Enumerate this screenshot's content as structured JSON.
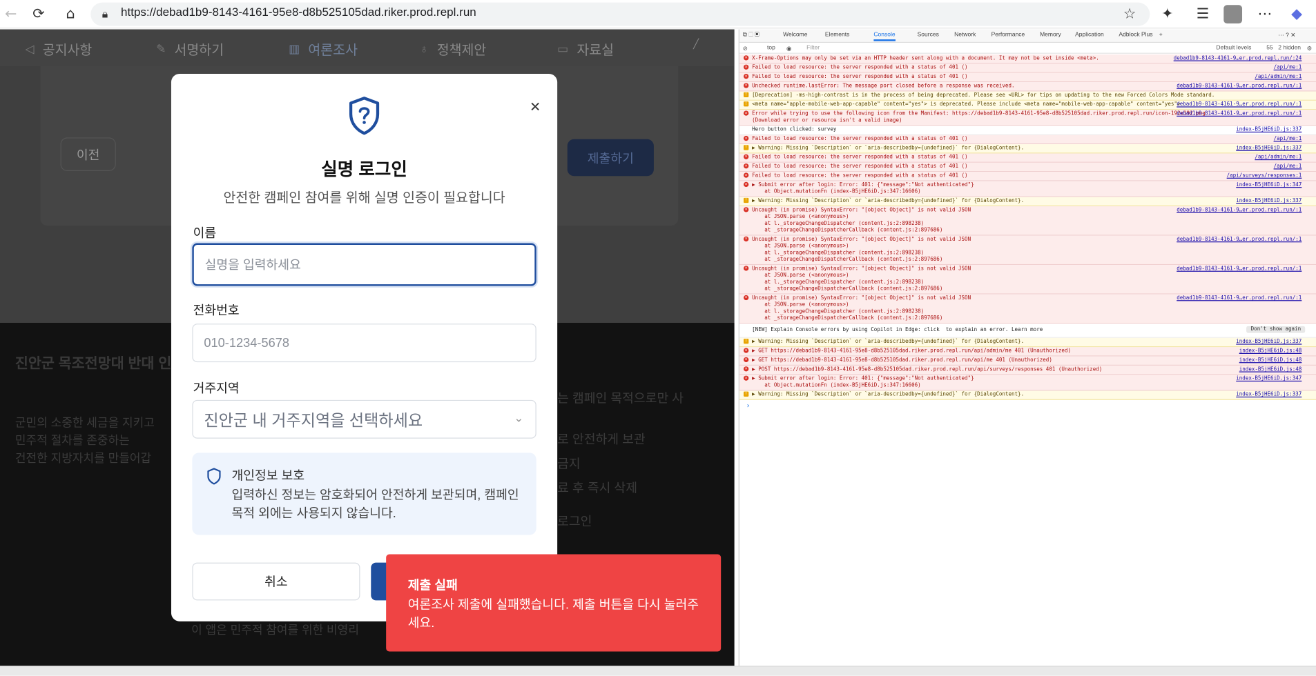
{
  "browser": {
    "url": "https://debad1b9-8143-4161-95e8-d8b525105dad.riker.prod.repl.run"
  },
  "nav": {
    "items": [
      "공지사항",
      "서명하기",
      "여론조사",
      "정책제안",
      "자료실"
    ]
  },
  "form": {
    "prev_label": "이전",
    "submit_label": "제출하기"
  },
  "footer": {
    "heading": "진안군 목조전망대 반대 인",
    "lines": [
      "군민의 소중한 세금을 지키고",
      "민주적 절차를 존중하는",
      "건전한 지방자치를 만들어갑"
    ],
    "right_lines": [
      "는 캠페인 목적으로만 사",
      "로 안전하게 보관",
      "금지",
      "료 후 즉시 삭제",
      "로그인"
    ],
    "note": "이 앱은 민주적 참여를 위한 비영리"
  },
  "modal": {
    "title": "실명 로그인",
    "subtitle": "안전한 캠페인 참여를 위해 실명 인증이 필요합니다",
    "name_label": "이름",
    "name_placeholder": "실명을 입력하세요",
    "phone_label": "전화번호",
    "phone_placeholder": "010-1234-5678",
    "region_label": "거주지역",
    "region_placeholder": "진안군 내 거주지역을 선택하세요",
    "privacy_title": "개인정보 보호",
    "privacy_body": "입력하신 정보는 암호화되어 안전하게 보관되며, 캠페인 목적 외에는 사용되지 않습니다.",
    "cancel_label": "취소"
  },
  "toast": {
    "title": "제출 실패",
    "message": "여론조사 제출에 실패했습니다. 제출 버튼을 다시 눌러주세요."
  },
  "devtools": {
    "tabs": [
      "Welcome",
      "Elements",
      "Console",
      "Sources",
      "Network",
      "Performance",
      "Memory",
      "Application",
      "Adblock Plus"
    ],
    "context": "top",
    "filter_placeholder": "Filter",
    "levels": "Default levels",
    "issues": "55",
    "hidden": "2 hidden",
    "rows": [
      {
        "t": "err",
        "msg": "X-Frame-Options may only be set via an HTTP header sent along with a document. It may not be set inside <meta>.",
        "src": "debad1b9-8143-4161-9…er.prod.repl.run/:24"
      },
      {
        "t": "err",
        "msg": "Failed to load resource: the server responded with a status of 401 ()",
        "src": "/api/me:1"
      },
      {
        "t": "err",
        "msg": "Failed to load resource: the server responded with a status of 401 ()",
        "src": "/api/admin/me:1"
      },
      {
        "t": "err",
        "msg": "Unchecked runtime.lastError: The message port closed before a response was received.",
        "src": "debad1b9-8143-4161-9…er.prod.repl.run/:1"
      },
      {
        "t": "warn",
        "msg": "[Deprecation] -ms-high-contrast is in the process of being deprecated. Please see <URL> for tips on updating to the new Forced Colors Mode standard.",
        "src": ""
      },
      {
        "t": "warn",
        "msg": "<meta name=\"apple-mobile-web-app-capable\" content=\"yes\"> is deprecated. Please include <meta name=\"mobile-web-app-capable\" content=\"yes\">",
        "src": "debad1b9-8143-4161-9…er.prod.repl.run/:1"
      },
      {
        "t": "err",
        "msg": "Error while trying to use the following icon from the Manifest: https://debad1b9-8143-4161-95e8-d8b525105dad.riker.prod.repl.run/icon-192x192.png\n(Download error or resource isn't a valid image)",
        "src": "debad1b9-8143-4161-9…er.prod.repl.run/:1"
      },
      {
        "t": "info",
        "msg": "Hero button clicked: survey",
        "src": "index-B5jHE6iD.js:337"
      },
      {
        "t": "err",
        "msg": "Failed to load resource: the server responded with a status of 401 ()",
        "src": "/api/me:1"
      },
      {
        "t": "warn",
        "msg": "▶ Warning: Missing `Description` or `aria-describedby={undefined}` for {DialogContent}.",
        "src": "index-B5jHE6iD.js:337"
      },
      {
        "t": "err",
        "msg": "Failed to load resource: the server responded with a status of 401 ()",
        "src": "/api/admin/me:1"
      },
      {
        "t": "err",
        "msg": "Failed to load resource: the server responded with a status of 401 ()",
        "src": "/api/me:1"
      },
      {
        "t": "err",
        "msg": "Failed to load resource: the server responded with a status of 401 ()",
        "src": "/api/surveys/responses:1"
      },
      {
        "t": "err",
        "msg": "▶ Submit error after login: Error: 401: {\"message\":\"Not authenticated\"}\n    at Object.mutationFn (index-B5jHE6iD.js:347:16606)",
        "src": "index-B5jHE6iD.js:347"
      },
      {
        "t": "warn",
        "msg": "▶ Warning: Missing `Description` or `aria-describedby={undefined}` for {DialogContent}.",
        "src": "index-B5jHE6iD.js:337"
      },
      {
        "t": "err",
        "msg": "Uncaught (in promise) SyntaxError: \"[object Object]\" is not valid JSON\n    at JSON.parse (<anonymous>)\n    at l._storageChangeDispatcher (content.js:2:898238)\n    at _storageChangeDispatcherCallback (content.js:2:897686)",
        "src": "debad1b9-8143-4161-9…er.prod.repl.run/:1"
      },
      {
        "t": "err",
        "msg": "Uncaught (in promise) SyntaxError: \"[object Object]\" is not valid JSON\n    at JSON.parse (<anonymous>)\n    at l._storageChangeDispatcher (content.js:2:898238)\n    at _storageChangeDispatcherCallback (content.js:2:897686)",
        "src": "debad1b9-8143-4161-9…er.prod.repl.run/:1"
      },
      {
        "t": "err",
        "msg": "Uncaught (in promise) SyntaxError: \"[object Object]\" is not valid JSON\n    at JSON.parse (<anonymous>)\n    at l._storageChangeDispatcher (content.js:2:898238)\n    at _storageChangeDispatcherCallback (content.js:2:897686)",
        "src": "debad1b9-8143-4161-9…er.prod.repl.run/:1"
      },
      {
        "t": "err",
        "msg": "Uncaught (in promise) SyntaxError: \"[object Object]\" is not valid JSON\n    at JSON.parse (<anonymous>)\n    at l._storageChangeDispatcher (content.js:2:898238)\n    at _storageChangeDispatcherCallback (content.js:2:897686)",
        "src": "debad1b9-8143-4161-9…er.prod.repl.run/:1"
      },
      {
        "t": "copilot",
        "msg": "[NEW] Explain Console errors by using Copilot in Edge: click  to explain an error. Learn more",
        "src": "Don't show again"
      },
      {
        "t": "warn",
        "msg": "▶ Warning: Missing `Description` or `aria-describedby={undefined}` for {DialogContent}.",
        "src": "index-B5jHE6iD.js:337"
      },
      {
        "t": "err",
        "msg": "▶ GET https://debad1b9-8143-4161-95e8-d8b525105dad.riker.prod.repl.run/api/admin/me 401 (Unauthorized)",
        "src": "index-B5jHE6iD.js:48"
      },
      {
        "t": "err",
        "msg": "▶ GET https://debad1b9-8143-4161-95e8-d8b525105dad.riker.prod.repl.run/api/me 401 (Unauthorized)",
        "src": "index-B5jHE6iD.js:48"
      },
      {
        "t": "err",
        "msg": "▶ POST https://debad1b9-8143-4161-95e8-d8b525105dad.riker.prod.repl.run/api/surveys/responses 401 (Unauthorized)",
        "src": "index-B5jHE6iD.js:48"
      },
      {
        "t": "err",
        "msg": "▶ Submit error after login: Error: 401: {\"message\":\"Not authenticated\"}\n    at Object.mutationFn (index-B5jHE6iD.js:347:16606)",
        "src": "index-B5jHE6iD.js:347"
      },
      {
        "t": "warn",
        "msg": "▶ Warning: Missing `Description` or `aria-describedby={undefined}` for {DialogContent}.",
        "src": "index-B5jHE6iD.js:337"
      }
    ]
  }
}
